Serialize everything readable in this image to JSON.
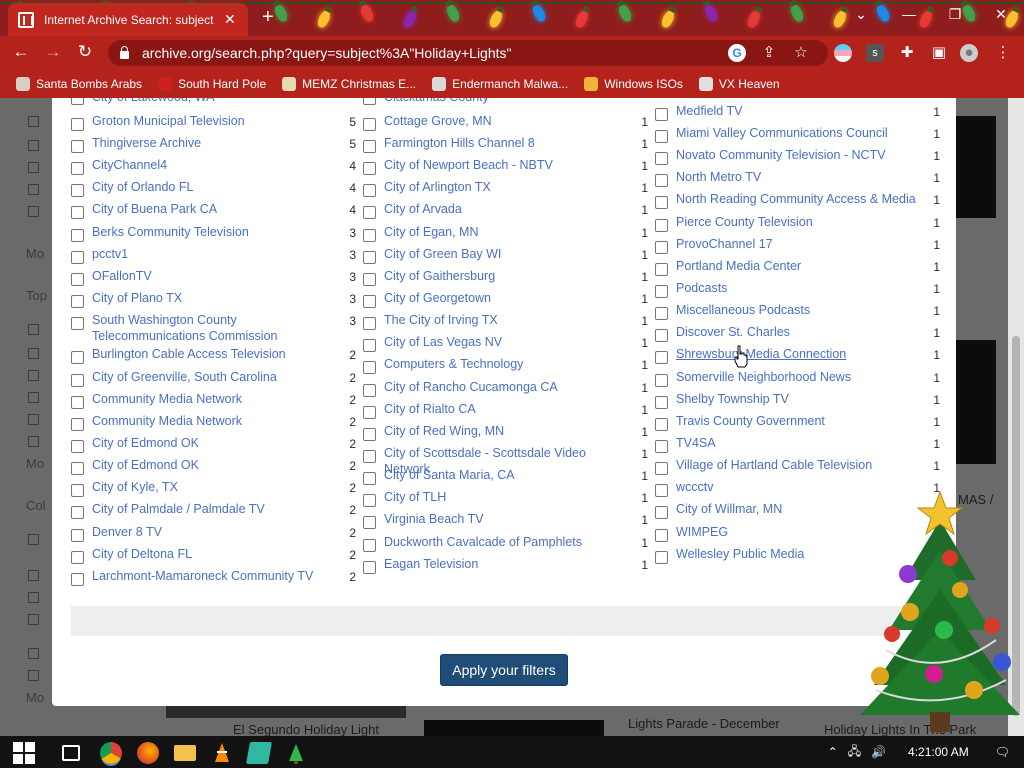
{
  "browser": {
    "tab_title": "Internet Archive Search: subject:",
    "tab_close": "✕",
    "new_tab": "+",
    "url": "archive.org/search.php?query=subject%3A\"Holiday+Lights\"",
    "bookmarks": [
      {
        "label": "Santa Bombs Arabs",
        "color": "#d6cfc4"
      },
      {
        "label": "South Hard Pole",
        "color": "#cc1f1f"
      },
      {
        "label": "MEMZ Christmas E...",
        "color": "#e8d9b5"
      },
      {
        "label": "Endermanch Malwa...",
        "color": "#d9d9d9"
      },
      {
        "label": "Windows ISOs",
        "color": "#f2b33d"
      },
      {
        "label": "VX Heaven",
        "color": "#e0e0e0"
      }
    ]
  },
  "modal": {
    "columns": [
      [
        {
          "label": "City of Lakewood, WA",
          "count": "",
          "cut": true
        },
        {
          "label": "Groton Municipal Television",
          "count": "5"
        },
        {
          "label": "Thingiverse Archive",
          "count": "5"
        },
        {
          "label": "CityChannel4",
          "count": "4"
        },
        {
          "label": "City of Orlando FL",
          "count": "4"
        },
        {
          "label": "City of Buena Park CA",
          "count": "4"
        },
        {
          "label": "Berks Community Television",
          "count": "3"
        },
        {
          "label": "pcctv1",
          "count": "3"
        },
        {
          "label": "OFallonTV",
          "count": "3"
        },
        {
          "label": "City of Plano TX",
          "count": "3"
        },
        {
          "label": "South Washington County Telecommunications Commission",
          "count": "3"
        },
        {
          "label": "Burlington Cable Access Television",
          "count": "2"
        },
        {
          "label": "City of Greenville, South Carolina",
          "count": "2"
        },
        {
          "label": "Community Media Network",
          "count": "2"
        },
        {
          "label": "Community Media Network",
          "count": "2"
        },
        {
          "label": "City of Edmond OK",
          "count": "2"
        },
        {
          "label": "City of Edmond OK",
          "count": "2"
        },
        {
          "label": "City of Kyle, TX",
          "count": "2"
        },
        {
          "label": "City of Palmdale / Palmdale TV",
          "count": "2"
        },
        {
          "label": "Denver 8 TV",
          "count": "2"
        },
        {
          "label": "City of Deltona FL",
          "count": "2"
        },
        {
          "label": "Larchmont-Mamaroneck Community TV",
          "count": "2"
        }
      ],
      [
        {
          "label": "Clackamas County",
          "count": "",
          "cut": true
        },
        {
          "label": "Cottage Grove, MN",
          "count": "1"
        },
        {
          "label": "Farmington Hills Channel 8",
          "count": "1"
        },
        {
          "label": "City of Newport Beach - NBTV",
          "count": "1"
        },
        {
          "label": "City of Arlington TX",
          "count": "1"
        },
        {
          "label": "City of Arvada",
          "count": "1"
        },
        {
          "label": "City of Egan, MN",
          "count": "1"
        },
        {
          "label": "City of Green Bay WI",
          "count": "1"
        },
        {
          "label": "City of Gaithersburg",
          "count": "1"
        },
        {
          "label": "City of Georgetown",
          "count": "1"
        },
        {
          "label": "The City of Irving TX",
          "count": "1"
        },
        {
          "label": "City of Las Vegas NV",
          "count": "1"
        },
        {
          "label": "Computers & Technology",
          "count": "1"
        },
        {
          "label": "City of Rancho Cucamonga CA",
          "count": "1"
        },
        {
          "label": "City of Rialto CA",
          "count": "1"
        },
        {
          "label": "City of Red Wing, MN",
          "count": "1"
        },
        {
          "label": "City of Scottsdale - Scottsdale Video Network",
          "count": "1"
        },
        {
          "label": "City of Santa Maria, CA",
          "count": "1"
        },
        {
          "label": "City of TLH",
          "count": "1"
        },
        {
          "label": "Virginia Beach TV",
          "count": "1"
        },
        {
          "label": "Duckworth Cavalcade of Pamphlets",
          "count": "1"
        },
        {
          "label": "Eagan Television",
          "count": "1"
        }
      ],
      [
        {
          "label": "Medfield TV",
          "count": "1"
        },
        {
          "label": "Miami Valley Communications Council",
          "count": "1"
        },
        {
          "label": "Novato Community Television - NCTV",
          "count": "1"
        },
        {
          "label": "North Metro TV",
          "count": "1"
        },
        {
          "label": "North Reading Community Access & Media",
          "count": "1"
        },
        {
          "label": "Pierce County Television",
          "count": "1"
        },
        {
          "label": "ProvoChannel 17",
          "count": "1"
        },
        {
          "label": "Portland Media Center",
          "count": "1"
        },
        {
          "label": "Podcasts",
          "count": "1"
        },
        {
          "label": "Miscellaneous Podcasts",
          "count": "1"
        },
        {
          "label": "Discover St. Charles",
          "count": "1"
        },
        {
          "label": "Shrewsbury Media Connection",
          "count": "1",
          "hover": true
        },
        {
          "label": "Somerville Neighborhood News",
          "count": "1"
        },
        {
          "label": "Shelby Township TV",
          "count": "1"
        },
        {
          "label": "Travis County Government",
          "count": "1"
        },
        {
          "label": "TV4SA",
          "count": "1"
        },
        {
          "label": "Village of Hartland Cable Television",
          "count": "1"
        },
        {
          "label": "wccctv",
          "count": "1"
        },
        {
          "label": "City of Willmar, MN",
          "count": "1"
        },
        {
          "label": "WIMPEG",
          "count": "1"
        },
        {
          "label": "Wellesley Public Media",
          "count": "1"
        }
      ]
    ],
    "apply_label": "Apply your filters"
  },
  "background": {
    "side_labels": [
      "Mo",
      "Top",
      "Mo",
      "Col",
      "Mo"
    ],
    "captions": [
      "El Segundo Holiday Light",
      "Lights Parade - December",
      "Holiday Lights In The Park",
      "MAS /"
    ]
  },
  "taskbar": {
    "clock": "4:21:00 AM"
  }
}
